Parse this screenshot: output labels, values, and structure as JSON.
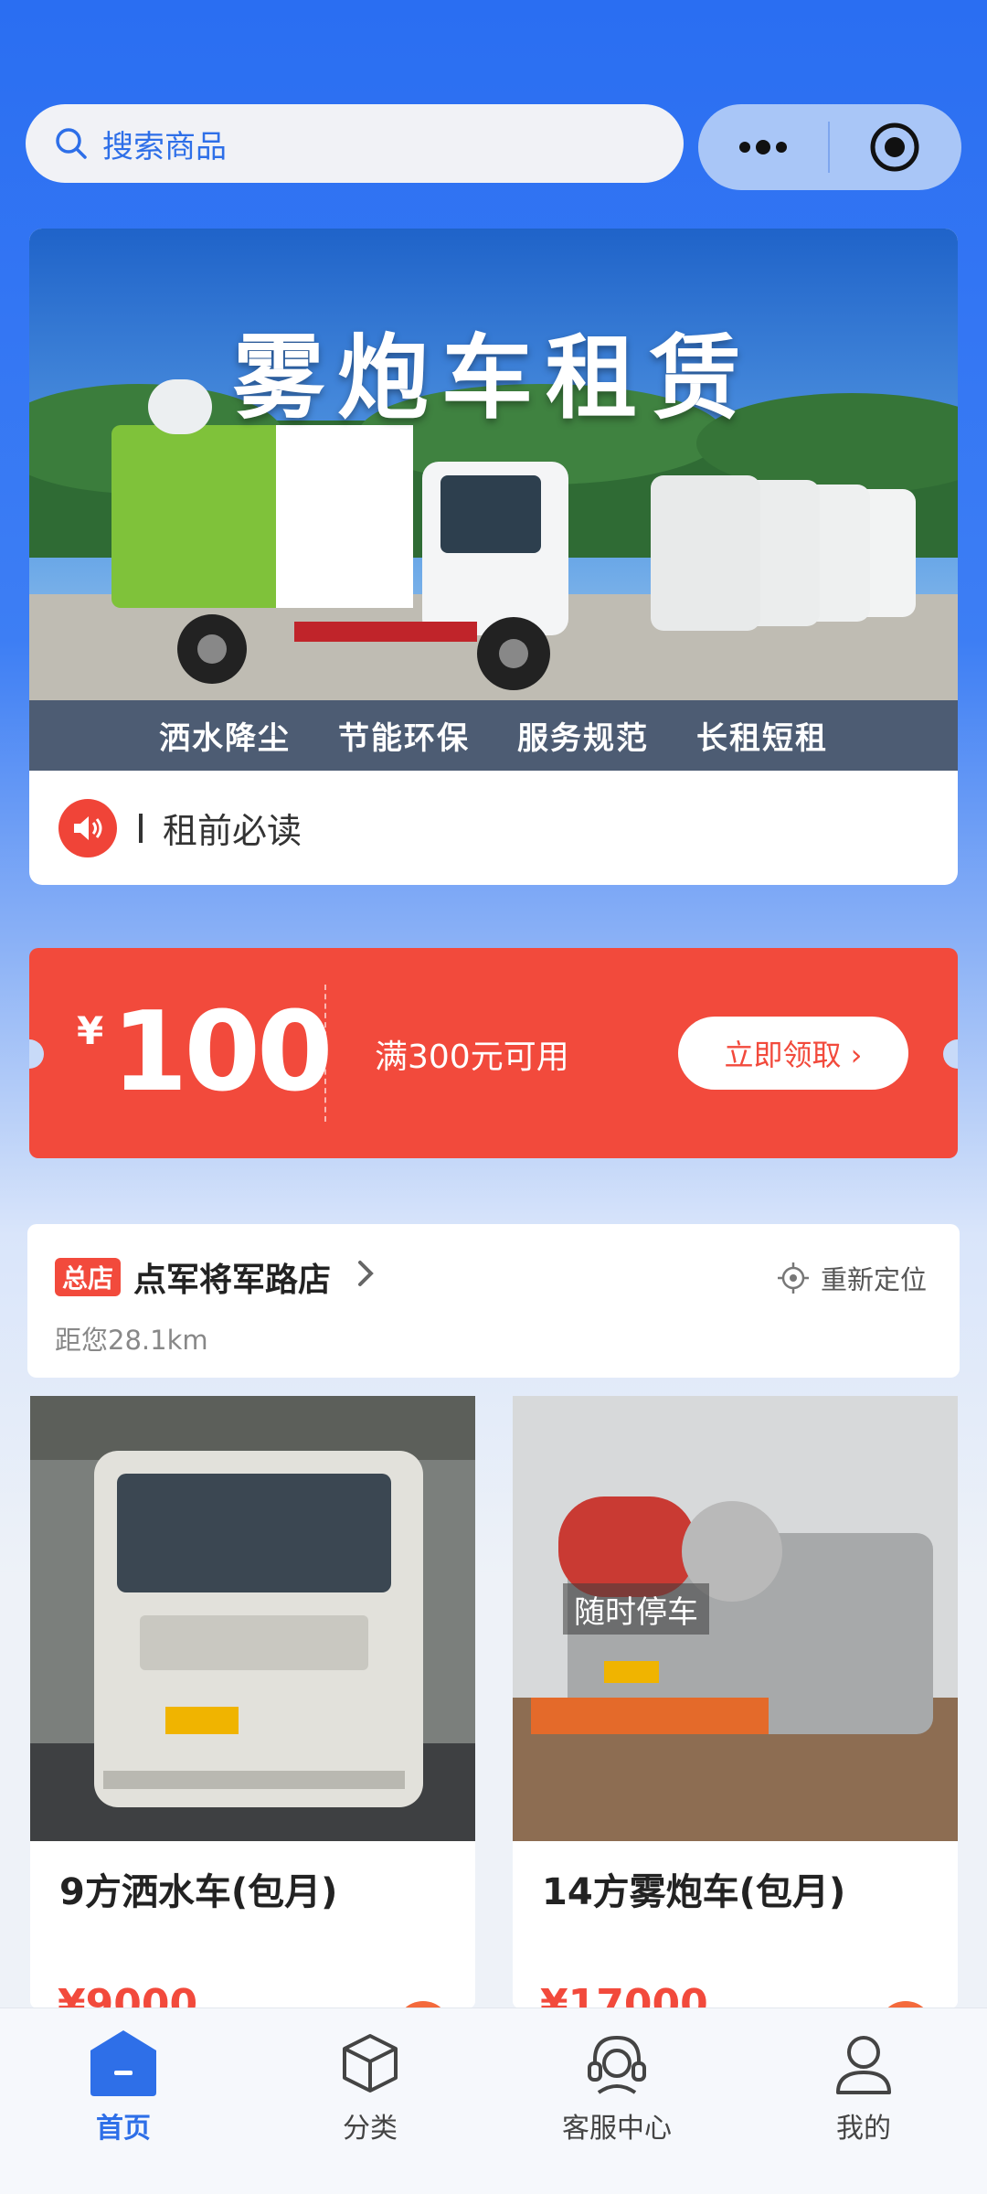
{
  "search": {
    "placeholder": "搜索商品"
  },
  "banner": {
    "title": "雾炮车租赁",
    "features": [
      "洒水降尘",
      "节能环保",
      "服务规范",
      "长租短租"
    ],
    "photo_sign": "随时停车"
  },
  "notice": {
    "text": "租前必读"
  },
  "coupon": {
    "currency": "¥",
    "amount": "100",
    "condition": "满300元可用",
    "claim_label": "立即领取 ›"
  },
  "store": {
    "tag": "总店",
    "name": "点军将军路店",
    "distance": "距您28.1km",
    "relocate_label": "重新定位"
  },
  "products": [
    {
      "title": "9方洒水车(包月)",
      "price": "¥9000"
    },
    {
      "title": "14方雾炮车(包月)",
      "price": "¥17000"
    }
  ],
  "tabs": [
    {
      "label": "首页",
      "icon": "home-icon",
      "active": true
    },
    {
      "label": "分类",
      "icon": "cube-icon",
      "active": false
    },
    {
      "label": "客服中心",
      "icon": "headset-icon",
      "active": false
    },
    {
      "label": "我的",
      "icon": "user-icon",
      "active": false
    }
  ],
  "colors": {
    "primary": "#2e6fe8",
    "accent_red": "#f24a3c"
  }
}
